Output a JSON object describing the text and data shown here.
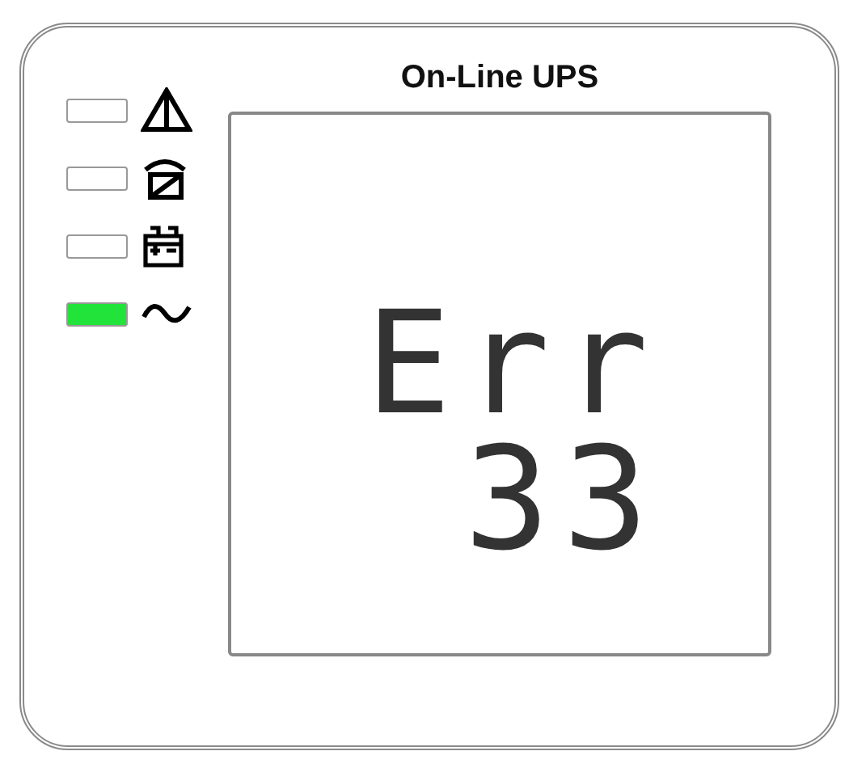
{
  "title": "On-Line UPS",
  "indicators": [
    {
      "kind": "fault",
      "on": false
    },
    {
      "kind": "bypass",
      "on": false
    },
    {
      "kind": "battery",
      "on": false
    },
    {
      "kind": "line",
      "on": true
    }
  ],
  "lcd": {
    "lines": [
      "Err",
      "33"
    ]
  }
}
